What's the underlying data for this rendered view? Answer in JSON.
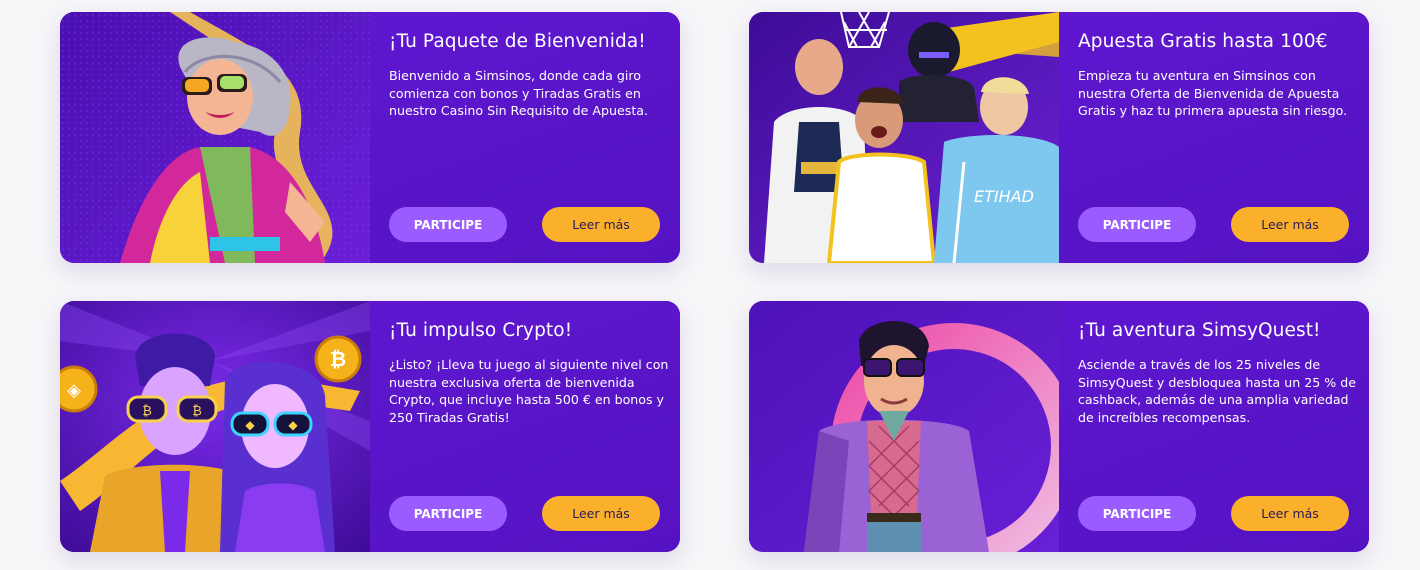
{
  "theme": {
    "card_bg": "#5a15c8",
    "join_button_color": "#9b5cff",
    "more_button_color": "#fbb02b",
    "page_bg": "#f6f5f8"
  },
  "cards": [
    {
      "art": "woman-with-glasses-illustration",
      "title": "¡Tu Paquete de Bienvenida!",
      "description": "Bienvenido a Simsinos, donde cada giro comienza con bonos y Tiradas Gratis en nuestro Casino Sin Requisito de Apuesta.",
      "join_label": "PARTICIPE",
      "more_label": "Leer más"
    },
    {
      "art": "sports-athletes-collage",
      "title": "Apuesta Gratis hasta 100€",
      "description": "Empieza tu aventura en Simsinos con nuestra Oferta de Bienvenida de Apuesta Gratis y haz tu primera apuesta sin riesgo.",
      "join_label": "PARTICIPE",
      "more_label": "Leer más"
    },
    {
      "art": "crypto-couple-illustration",
      "title": "¡Tu impulso Crypto!",
      "description": "¿Listo? ¡Lleva tu juego al siguiente nivel con nuestra exclusiva oferta de bienvenida Crypto, que incluye hasta 500 € en bonos y 250 Tiradas Gratis!",
      "join_label": "PARTICIPE",
      "more_label": "Leer más"
    },
    {
      "art": "man-in-coat-illustration",
      "title": "¡Tu aventura SimsyQuest!",
      "description": "Asciende a través de los 25 niveles de SimsyQuest y desbloquea hasta un 25 % de cashback, además de una amplia variedad de increíbles recompensas.",
      "join_label": "PARTICIPE",
      "more_label": "Leer más"
    }
  ]
}
